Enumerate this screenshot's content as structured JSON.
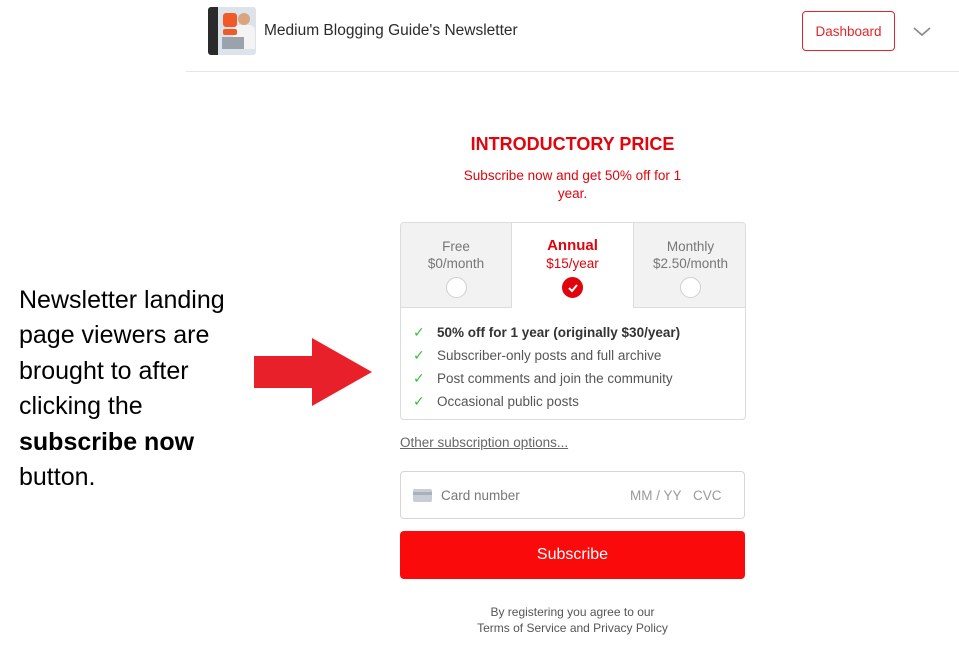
{
  "header": {
    "publication_name": "Medium Blogging Guide's Newsletter",
    "dashboard_label": "Dashboard"
  },
  "annotation": {
    "line1": "Newsletter landing",
    "line2": "page viewers are",
    "line3": "brought to after",
    "line4": "clicking the",
    "bold": "subscribe now",
    "line6": "button."
  },
  "promo": {
    "title": "INTRODUCTORY PRICE",
    "subtitle": "Subscribe now and get 50% off for 1 year."
  },
  "plans": [
    {
      "name": "Free",
      "price": "$0/month",
      "selected": false
    },
    {
      "name": "Annual",
      "price": "$15/year",
      "selected": true
    },
    {
      "name": "Monthly",
      "price": "$2.50/month",
      "selected": false
    }
  ],
  "features": [
    "50% off for 1 year (originally $30/year)",
    "Subscriber-only posts and full archive",
    "Post comments and join the community",
    "Occasional public posts"
  ],
  "other_options": "Other subscription options...",
  "card": {
    "number_placeholder": "Card number",
    "expiry_placeholder": "MM / YY",
    "cvc_placeholder": "CVC"
  },
  "subscribe_label": "Subscribe",
  "legal": {
    "line1": "By registering you agree to our",
    "line2": "Terms of Service and Privacy Policy"
  },
  "colors": {
    "accent": "#e0040c",
    "button": "#fa0a0a",
    "check": "#3dbb3d",
    "arrow": "#e8202a"
  },
  "icons": {
    "chevron": "chevron-down-icon",
    "card": "credit-card-icon",
    "check": "checkmark-icon"
  }
}
